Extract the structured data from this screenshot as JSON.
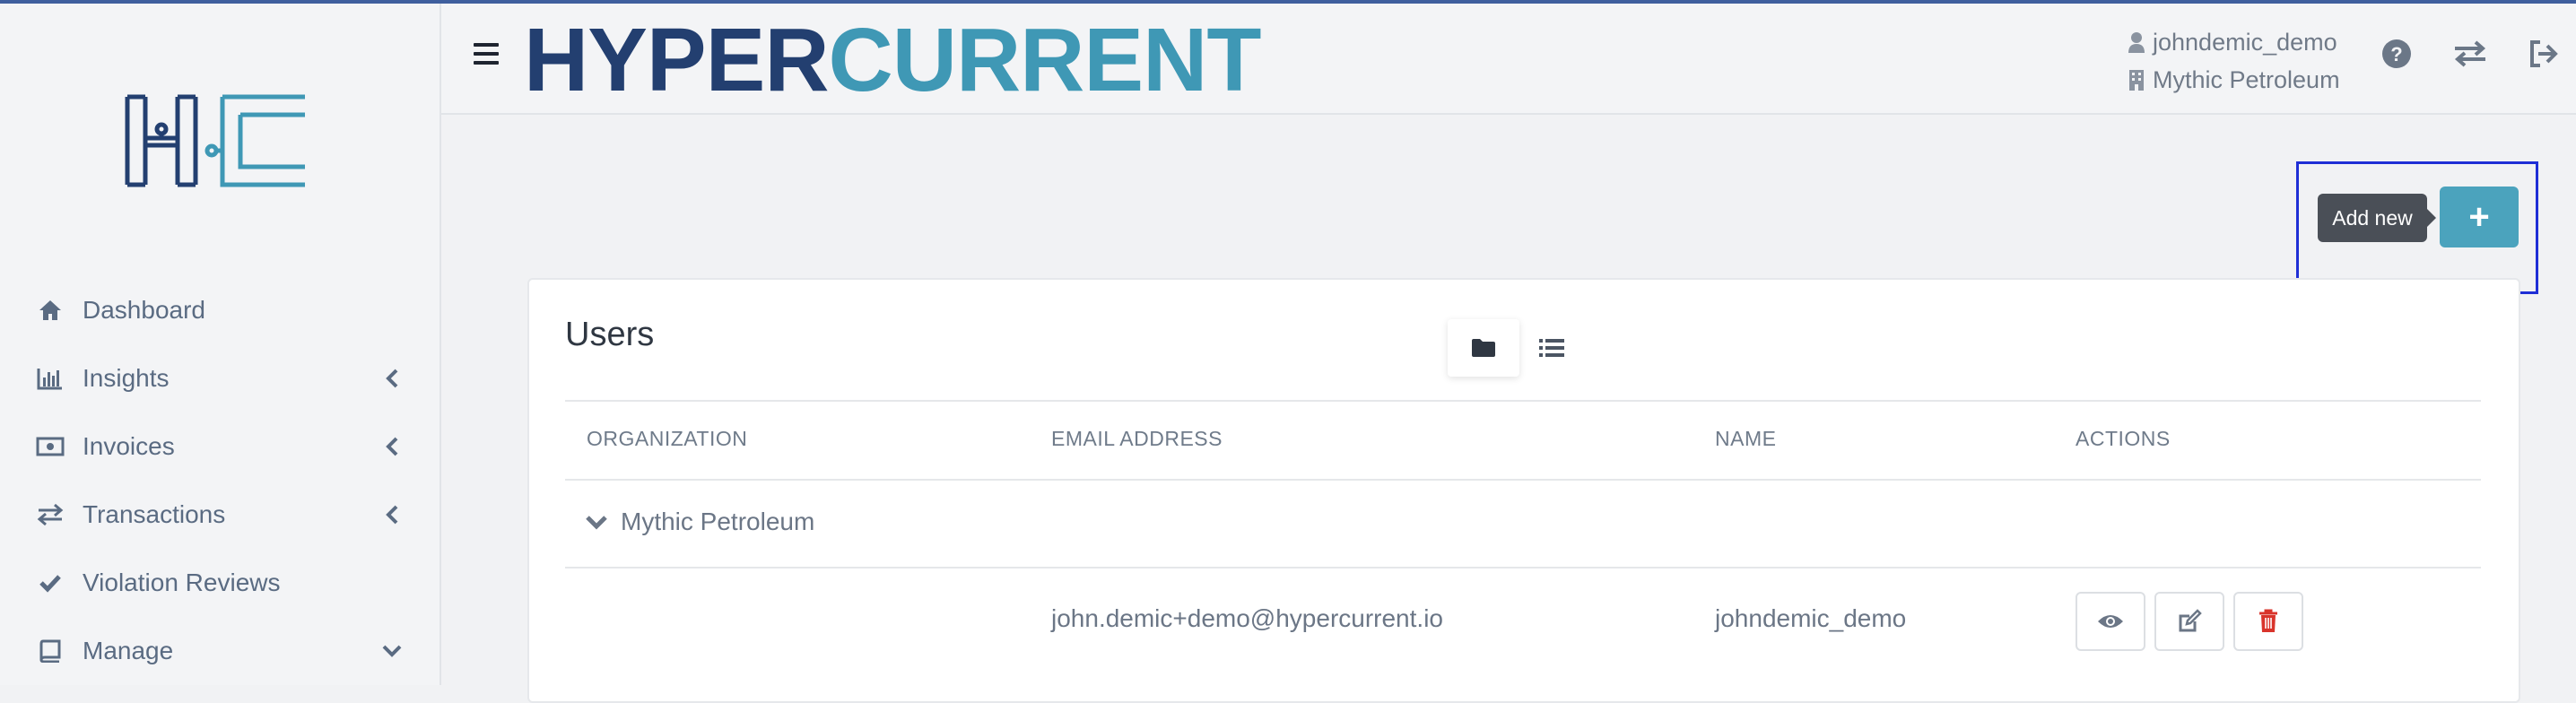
{
  "brand": {
    "part1": "HYPER",
    "part2": "CURRENT"
  },
  "header": {
    "username": "johndemic_demo",
    "organization": "Mythic Petroleum"
  },
  "sidebar": {
    "items": [
      {
        "label": "Dashboard",
        "icon": "home-icon"
      },
      {
        "label": "Insights",
        "icon": "bar-chart-icon"
      },
      {
        "label": "Invoices",
        "icon": "money-icon"
      },
      {
        "label": "Transactions",
        "icon": "exchange-icon"
      },
      {
        "label": "Violation Reviews",
        "icon": "check-icon"
      },
      {
        "label": "Manage",
        "icon": "book-icon"
      }
    ]
  },
  "toolbar": {
    "add_tooltip": "Add new",
    "add_label": "+"
  },
  "card": {
    "title": "Users",
    "columns": [
      "ORGANIZATION",
      "EMAIL ADDRESS",
      "NAME",
      "ACTIONS"
    ],
    "group": "Mythic Petroleum",
    "rows": [
      {
        "email": "john.demic+demo@hypercurrent.io",
        "name": "johndemic_demo"
      }
    ]
  },
  "colors": {
    "brand_dark": "#233f70",
    "brand_light": "#3f98b5",
    "accent": "#4ba3bd",
    "danger": "#d9342b"
  }
}
